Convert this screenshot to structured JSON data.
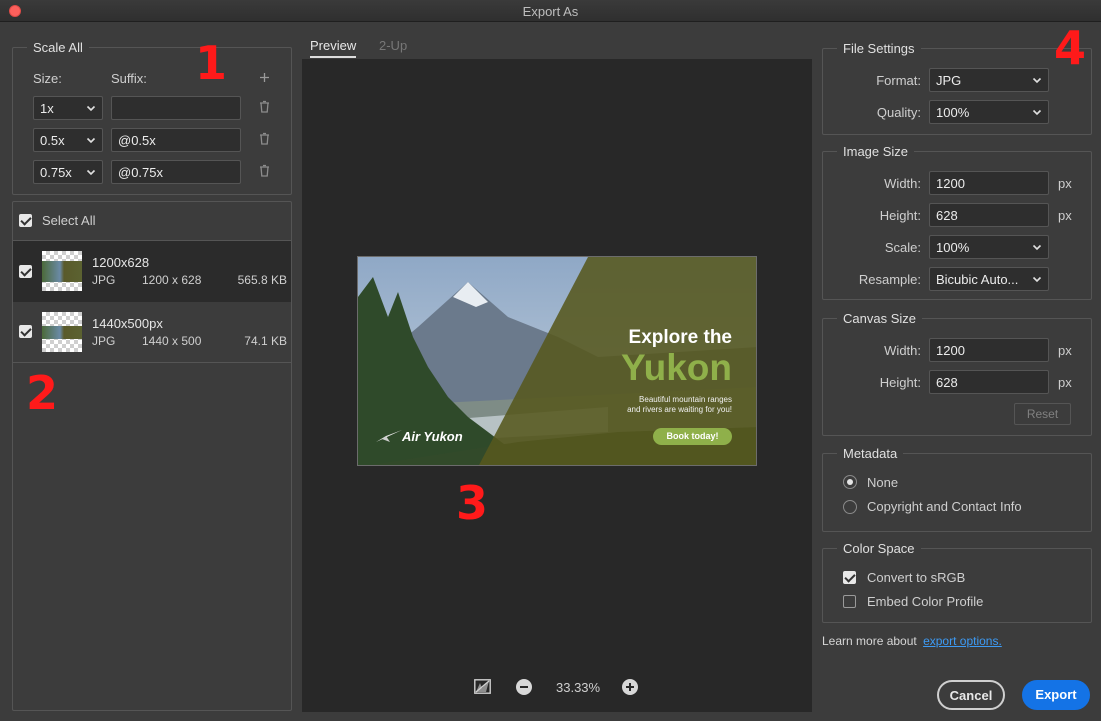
{
  "window": {
    "title": "Export As"
  },
  "scale_all": {
    "legend": "Scale All",
    "size_label": "Size:",
    "suffix_label": "Suffix:",
    "add_icon": "plus-icon",
    "rows": [
      {
        "size": "1x",
        "suffix": ""
      },
      {
        "size": "0.5x",
        "suffix": "@0.5x"
      },
      {
        "size": "0.75x",
        "suffix": "@0.75x"
      }
    ]
  },
  "assets": {
    "select_all_label": "Select All",
    "items": [
      {
        "name": "1200x628",
        "format": "JPG",
        "dims": "1200 x 628",
        "size": "565.8 KB",
        "checked": true
      },
      {
        "name": "1440x500px",
        "format": "JPG",
        "dims": "1440 x 500",
        "size": "74.1 KB",
        "checked": true
      }
    ]
  },
  "preview": {
    "tabs": [
      "Preview",
      "2-Up"
    ],
    "active_tab": "Preview",
    "zoom": "33.33%",
    "banner": {
      "heading": "Explore the",
      "big": "Yukon",
      "sub1": "Beautiful mountain ranges",
      "sub2": "and rivers are waiting for you!",
      "cta": "Book today!",
      "brand": "Air Yukon"
    }
  },
  "file_settings": {
    "legend": "File Settings",
    "format_label": "Format:",
    "format": "JPG",
    "quality_label": "Quality:",
    "quality": "100%"
  },
  "image_size": {
    "legend": "Image Size",
    "width_label": "Width:",
    "width": "1200",
    "height_label": "Height:",
    "height": "628",
    "unit": "px",
    "scale_label": "Scale:",
    "scale": "100%",
    "resample_label": "Resample:",
    "resample": "Bicubic Auto..."
  },
  "canvas_size": {
    "legend": "Canvas Size",
    "width_label": "Width:",
    "width": "1200",
    "height_label": "Height:",
    "height": "628",
    "unit": "px",
    "reset_label": "Reset"
  },
  "metadata": {
    "legend": "Metadata",
    "options": [
      "None",
      "Copyright and Contact Info"
    ],
    "selected": "None"
  },
  "color_space": {
    "legend": "Color Space",
    "convert_label": "Convert to sRGB",
    "convert_checked": true,
    "embed_label": "Embed Color Profile",
    "embed_checked": false
  },
  "footer": {
    "learn_text": "Learn more about",
    "learn_link": "export options.",
    "cancel_label": "Cancel",
    "export_label": "Export"
  },
  "annotations": [
    "1",
    "2",
    "3",
    "4"
  ],
  "colors": {
    "accent": "#1473e6",
    "link": "#3d9bf5",
    "annotation": "#ff1a1a",
    "banner_green": "#8fb04a"
  }
}
